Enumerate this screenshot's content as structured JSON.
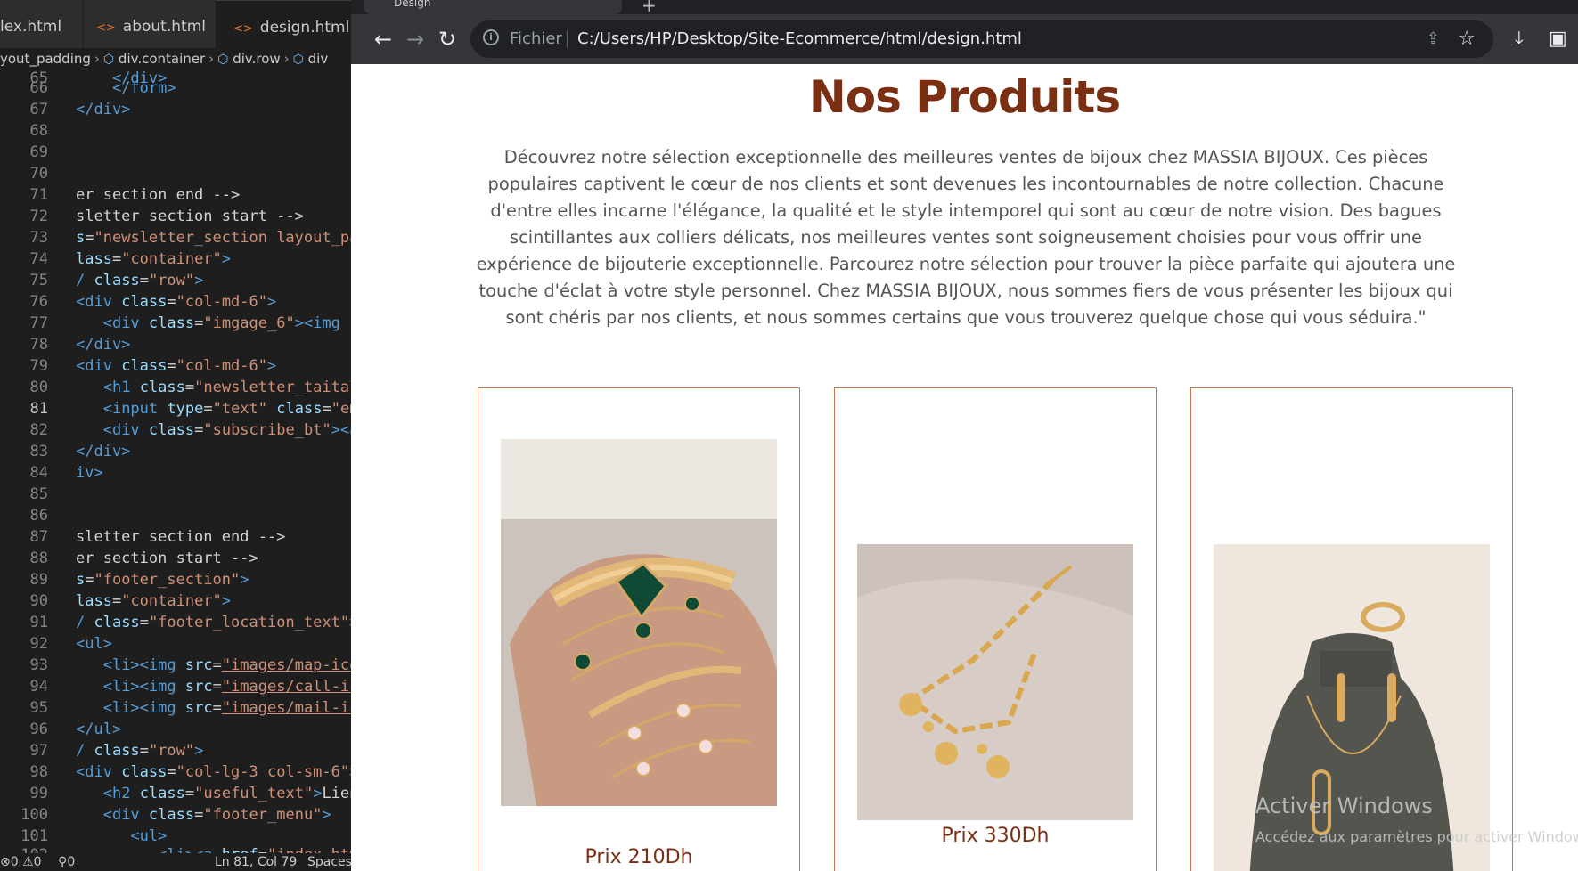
{
  "editor": {
    "tabs": [
      {
        "label": "lex.html"
      },
      {
        "label": "about.html"
      },
      {
        "label": "design.html"
      }
    ],
    "breadcrumb": [
      "yout_padding",
      "div.container",
      "div.row",
      "div"
    ],
    "status": {
      "problems": "0",
      "warnings": "0",
      "ports": "0",
      "position": "Ln 81, Col 79",
      "spaces": "Spaces:"
    }
  },
  "browser": {
    "tab_title": "Design",
    "url_scheme_label": "Fichier",
    "url": "C:/Users/HP/Desktop/Site-Ecommerce/html/design.html"
  },
  "page": {
    "title": "Nos Produits",
    "intro": "Découvrez notre sélection exceptionnelle des meilleures ventes de bijoux chez MASSIA BIJOUX. Ces pièces populaires captivent le cœur de nos clients et sont devenues les incontournables de notre collection. Chacune d'entre elles incarne l'élégance, la qualité et le style intemporel qui sont au cœur de notre vision. Des bagues scintillantes aux colliers délicats, nos meilleures ventes sont soigneusement choisies pour vous offrir une expérience de bijouterie exceptionnelle. Parcourez notre sélection pour trouver la pièce parfaite qui ajoutera une touche d'éclat à votre style personnel. Chez MASSIA BIJOUX, nous sommes fiers de vous présenter les bijoux qui sont chéris par nos clients, et nous sommes certains que vous trouverez quelque chose qui vous séduira.\"",
    "products": [
      {
        "price": "Prix 210Dh"
      },
      {
        "price": "Prix 330Dh"
      },
      {
        "price": ""
      }
    ]
  },
  "os_overlay": {
    "line1": "Activer Windows",
    "line2": "Accédez aux paramètres pour activer Windows"
  }
}
